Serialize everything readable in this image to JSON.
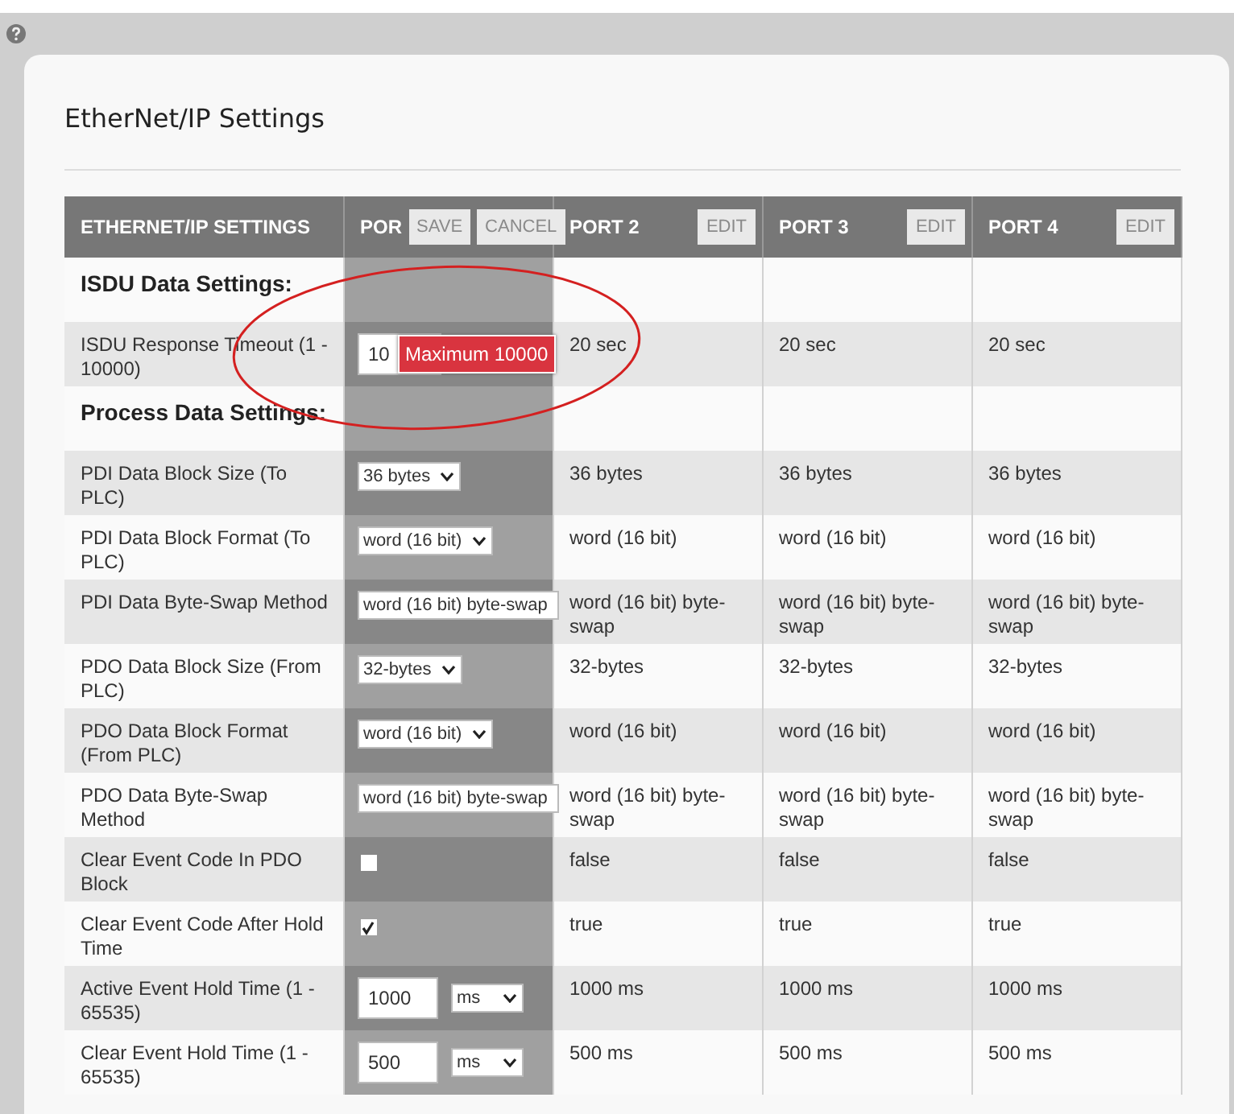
{
  "title": "EtherNet/IP Settings",
  "table": {
    "columns": [
      {
        "kind": "label",
        "label": "ETHERNET/IP SETTINGS"
      },
      {
        "kind": "editing",
        "label": "POR",
        "buttons": [
          "SAVE",
          "CANCEL"
        ]
      },
      {
        "kind": "view",
        "label": "PORT 2",
        "buttons": [
          "EDIT"
        ]
      },
      {
        "kind": "view",
        "label": "PORT 3",
        "buttons": [
          "EDIT"
        ]
      },
      {
        "kind": "view",
        "label": "PORT 4",
        "buttons": [
          "EDIT"
        ]
      }
    ],
    "rows": [
      {
        "kind": "section",
        "label": "ISDU Data Settings:"
      },
      {
        "kind": "setting",
        "label": "ISDU Response Timeout (1 - 10000)",
        "editor": {
          "kind": "text",
          "value": "10",
          "tooltip": "Maximum 10000"
        },
        "values": [
          "20 sec",
          "20 sec",
          "20 sec"
        ]
      },
      {
        "kind": "section",
        "label": "Process Data Settings:"
      },
      {
        "kind": "setting",
        "label": "PDI Data Block Size (To PLC)",
        "editor": {
          "kind": "select",
          "value": "36 bytes"
        },
        "values": [
          "36 bytes",
          "36 bytes",
          "36 bytes"
        ]
      },
      {
        "kind": "setting",
        "label": "PDI Data Block Format (To PLC)",
        "editor": {
          "kind": "select",
          "value": "word (16 bit)"
        },
        "values": [
          "word (16 bit)",
          "word (16 bit)",
          "word (16 bit)"
        ]
      },
      {
        "kind": "setting",
        "label": "PDI Data Byte-Swap Method",
        "editor": {
          "kind": "wide",
          "value": "word (16 bit) byte-swap"
        },
        "values": [
          "word (16 bit) byte-swap",
          "word (16 bit) byte-swap",
          "word (16 bit) byte-swap"
        ]
      },
      {
        "kind": "setting",
        "label": "PDO Data Block Size (From PLC)",
        "editor": {
          "kind": "select",
          "value": "32-bytes"
        },
        "values": [
          "32-bytes",
          "32-bytes",
          "32-bytes"
        ]
      },
      {
        "kind": "setting",
        "label": "PDO Data Block Format (From PLC)",
        "editor": {
          "kind": "select",
          "value": "word (16 bit)"
        },
        "values": [
          "word (16 bit)",
          "word (16 bit)",
          "word (16 bit)"
        ]
      },
      {
        "kind": "setting",
        "label": "PDO Data Byte-Swap Method",
        "editor": {
          "kind": "wide",
          "value": "word (16 bit) byte-swap"
        },
        "values": [
          "word (16 bit) byte-swap",
          "word (16 bit) byte-swap",
          "word (16 bit) byte-swap"
        ]
      },
      {
        "kind": "setting",
        "label": "Clear Event Code In PDO Block",
        "editor": {
          "kind": "checkbox",
          "checked": false
        },
        "values": [
          "false",
          "false",
          "false"
        ]
      },
      {
        "kind": "setting",
        "label": "Clear Event Code After Hold Time",
        "editor": {
          "kind": "checkbox",
          "checked": true
        },
        "values": [
          "true",
          "true",
          "true"
        ]
      },
      {
        "kind": "setting",
        "label": "Active Event Hold Time (1 - 65535)",
        "editor": {
          "kind": "unit",
          "value": "1000",
          "unit": "ms"
        },
        "values": [
          "1000 ms",
          "1000 ms",
          "1000 ms"
        ]
      },
      {
        "kind": "setting",
        "label": "Clear Event Hold Time (1 - 65535)",
        "editor": {
          "kind": "unit",
          "value": "500",
          "unit": "ms"
        },
        "values": [
          "500 ms",
          "500 ms",
          "500 ms"
        ]
      }
    ]
  }
}
